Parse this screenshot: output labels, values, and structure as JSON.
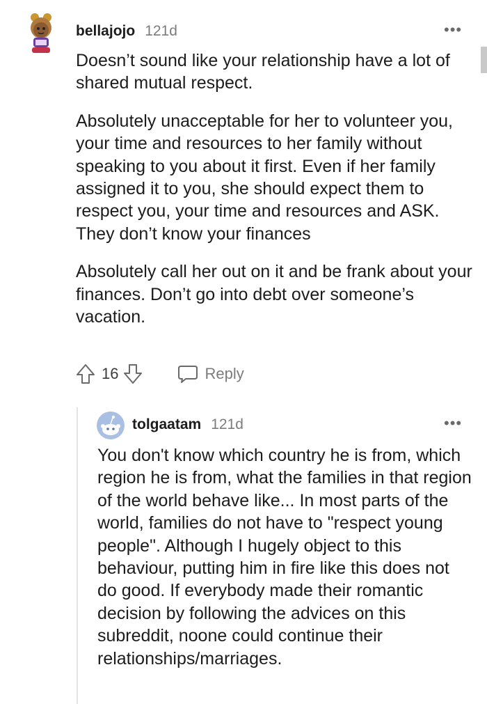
{
  "comment": {
    "username": "bellajojo",
    "age": "121d",
    "paragraphs": [
      "Doesn’t sound like your relationship have a lot of shared mutual respect.",
      "Absolutely unacceptable for her to volunteer you, your time and resources to her family without speaking to you about it first. Even if her family assigned it to you, she should expect them to respect you, your time and resources and ASK. They don’t know your finances",
      "Absolutely call her out on it and be frank about your finances. Don’t go into debt over someone’s vacation."
    ],
    "score": "16",
    "reply_label": "Reply",
    "more_label": "•••"
  },
  "reply": {
    "username": "tolgaatam",
    "age": "121d",
    "text": "You don't know which country he is from, which region he is from, what the families in that region of the world behave like... In most parts of the world, families do not have to \"respect young people\". Although I hugely object to this behaviour, putting him in fire like this does not do good. If everybody made their romantic decision by following the advices on this subreddit, noone could continue their relationships/marriages.",
    "more_label": "•••"
  }
}
